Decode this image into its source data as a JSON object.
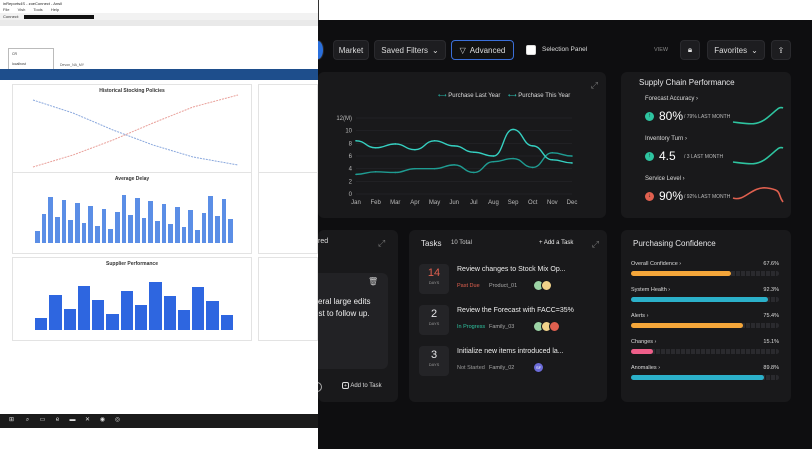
{
  "toolbar": {
    "market_label": "Market",
    "saved_filters_label": "Saved Filters",
    "advanced_label": "Advanced",
    "selection_panel_label": "Selection Panel",
    "view_label": "VIEW",
    "favorites_label": "Favorites"
  },
  "forecast_chart": {
    "legend_last_year": "Purchase Last Year",
    "legend_this_year": "Purchase This Year",
    "y_unit": "12(M)"
  },
  "chart_data": {
    "type": "line",
    "categories": [
      "Jan",
      "Feb",
      "Mar",
      "Apr",
      "May",
      "Jun",
      "Jul",
      "Aug",
      "Sep",
      "Oct",
      "Nov",
      "Dec"
    ],
    "series": [
      {
        "name": "Purchase Last Year",
        "values": [
          3.1,
          3.5,
          3.4,
          4.0,
          4.0,
          4.6,
          3.4,
          5.1,
          5.6,
          4.2,
          6.5,
          6.0
        ]
      },
      {
        "name": "Purchase This Year",
        "values": [
          8.4,
          7.3,
          7.9,
          7.0,
          8.4,
          7.6,
          6.6,
          6.0,
          10.2,
          7.6,
          5.4,
          4.9
        ]
      }
    ],
    "yticks": [
      0,
      2,
      4,
      6,
      8,
      10,
      12
    ],
    "ylim": [
      0,
      12
    ],
    "grid": true,
    "legend": "top-right",
    "colors": {
      "Purchase Last Year": "#26b5a7",
      "Purchase This Year": "#2ec4b6"
    }
  },
  "supply_chain": {
    "title": "Supply Chain Performance",
    "metrics": [
      {
        "label": "Forecast Accuracy",
        "value": "80%",
        "sub": "/ 79% LAST MONTH",
        "dir": "up",
        "color": "#2ec4a0"
      },
      {
        "label": "Inventory Turn",
        "value": "4.5",
        "sub": "/ 3 LAST MONTH",
        "dir": "up",
        "color": "#2ec4a0"
      },
      {
        "label": "Service Level",
        "value": "90%",
        "sub": "/ 92% LAST MONTH",
        "dir": "down",
        "color": "#e0604f"
      }
    ]
  },
  "note_panel": {
    "title_fragment": "red",
    "text_line1": "veral large edits",
    "text_line2": "est to follow up.",
    "add_to_task": "Add to Task"
  },
  "tasks": {
    "title": "Tasks",
    "total": "10 Total",
    "add_label": "+ Add a Task",
    "items": [
      {
        "day": "14",
        "unit": "DAYS",
        "title": "Review changes to Stock Mix Op...",
        "status": "Past Due",
        "status_color": "#e0604f",
        "family": "Product_01",
        "day_color": "#e0604f"
      },
      {
        "day": "2",
        "unit": "DAYS",
        "title": "Review the Forecast with FACC=35%",
        "status": "In Progress",
        "status_color": "#2ec4a0",
        "family": "Family_03",
        "day_color": "#e6e6e8"
      },
      {
        "day": "3",
        "unit": "DAYS",
        "title": "Initialize new items introduced la...",
        "status": "Not Started",
        "status_color": "#999999",
        "family": "Family_02",
        "day_color": "#e6e6e8"
      }
    ],
    "avatar_sf": "SF"
  },
  "purchasing": {
    "title": "Purchasing Confidence",
    "rows": [
      {
        "label": "Overall Confidence",
        "pct": "67.6%",
        "value": 0.676,
        "color": "#f4a63a"
      },
      {
        "label": "System Health",
        "pct": "92.3%",
        "value": 0.923,
        "color": "#2bb0c9"
      },
      {
        "label": "Alerts",
        "pct": "75.4%",
        "value": 0.754,
        "color": "#f4a63a"
      },
      {
        "label": "Changes",
        "pct": "15.1%",
        "value": 0.151,
        "color": "#ef5f8a"
      },
      {
        "label": "Anomalies",
        "pct": "89.8%",
        "value": 0.898,
        "color": "#2bb0c9"
      }
    ]
  },
  "left_app": {
    "window_title": "inReports4S - zoeConnect - Ansll",
    "menu": [
      "File",
      "Vish",
      "Tools",
      "Help"
    ],
    "connect_label": "Connect:",
    "tab_label": "Devon_NA_MY",
    "popup_line1": "CR",
    "popup_line2": "localhost",
    "chart1_title": "Historical Stocking Policies",
    "chart2_title": "Average Delay",
    "chart3_title": "Supplier Performance"
  }
}
